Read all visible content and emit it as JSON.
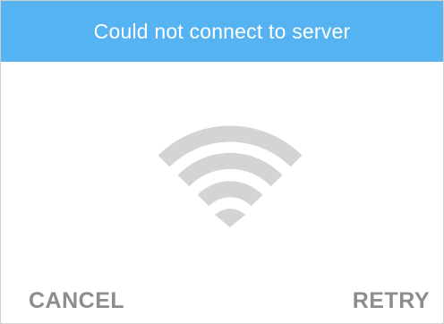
{
  "dialog": {
    "title": "Could not connect to server",
    "icon": "wifi-icon",
    "cancel_label": "CANCEL",
    "retry_label": "RETRY"
  },
  "colors": {
    "header_bg": "#55b3f2",
    "header_text": "#ffffff",
    "icon": "#d4d4d4",
    "button_text": "#8d8d8d"
  }
}
